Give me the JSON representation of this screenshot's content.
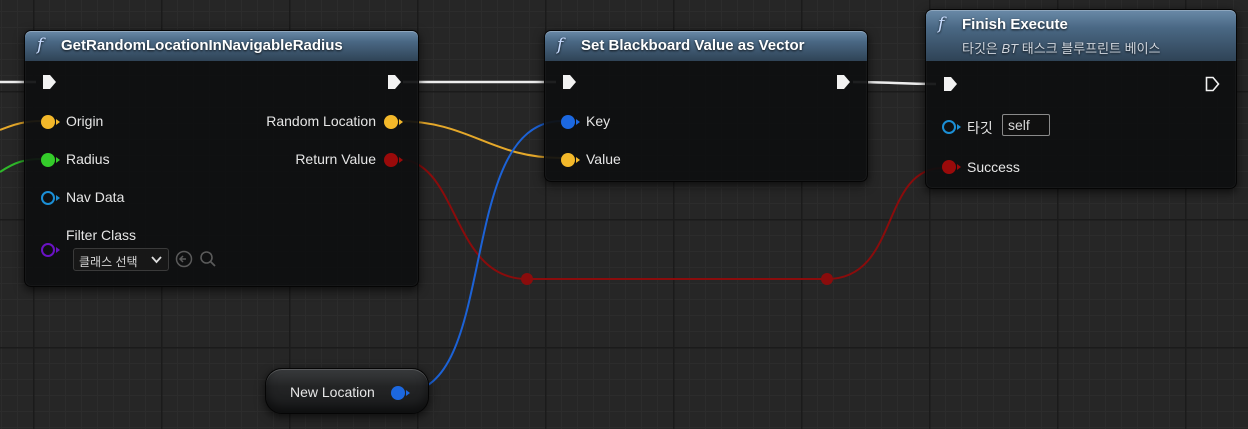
{
  "colors": {
    "exec_wire": "#f0f0f0",
    "vector_pin": "#f3b82a",
    "float_pin": "#34cc2a",
    "bool_pin": "#9a0a0a",
    "object_pin": "#1c68e0",
    "nav_pin": "#1b8fd6",
    "class_pin": "#6a12c4",
    "header": "#4a6884"
  },
  "nodes": {
    "get_random": {
      "function_icon": "f",
      "title": "GetRandomLocationInNavigableRadius",
      "inputs": {
        "origin": "Origin",
        "radius": "Radius",
        "nav_data": "Nav Data",
        "filter_class": "Filter Class"
      },
      "filter_combo": "클래스 선택",
      "outputs": {
        "random_location": "Random Location",
        "return_value": "Return Value"
      }
    },
    "set_blackboard": {
      "function_icon": "f",
      "title": "Set Blackboard Value as Vector",
      "inputs": {
        "key": "Key",
        "value": "Value"
      }
    },
    "finish_execute": {
      "function_icon": "f",
      "title": "Finish Execute",
      "subtitle_pre": "타깃은 ",
      "subtitle_bt": "BT",
      "subtitle_post": " 태스크 블루프린트 베이스",
      "inputs": {
        "target": "타깃",
        "target_value": "self",
        "success": "Success"
      }
    },
    "new_location": {
      "label": "New Location"
    }
  }
}
